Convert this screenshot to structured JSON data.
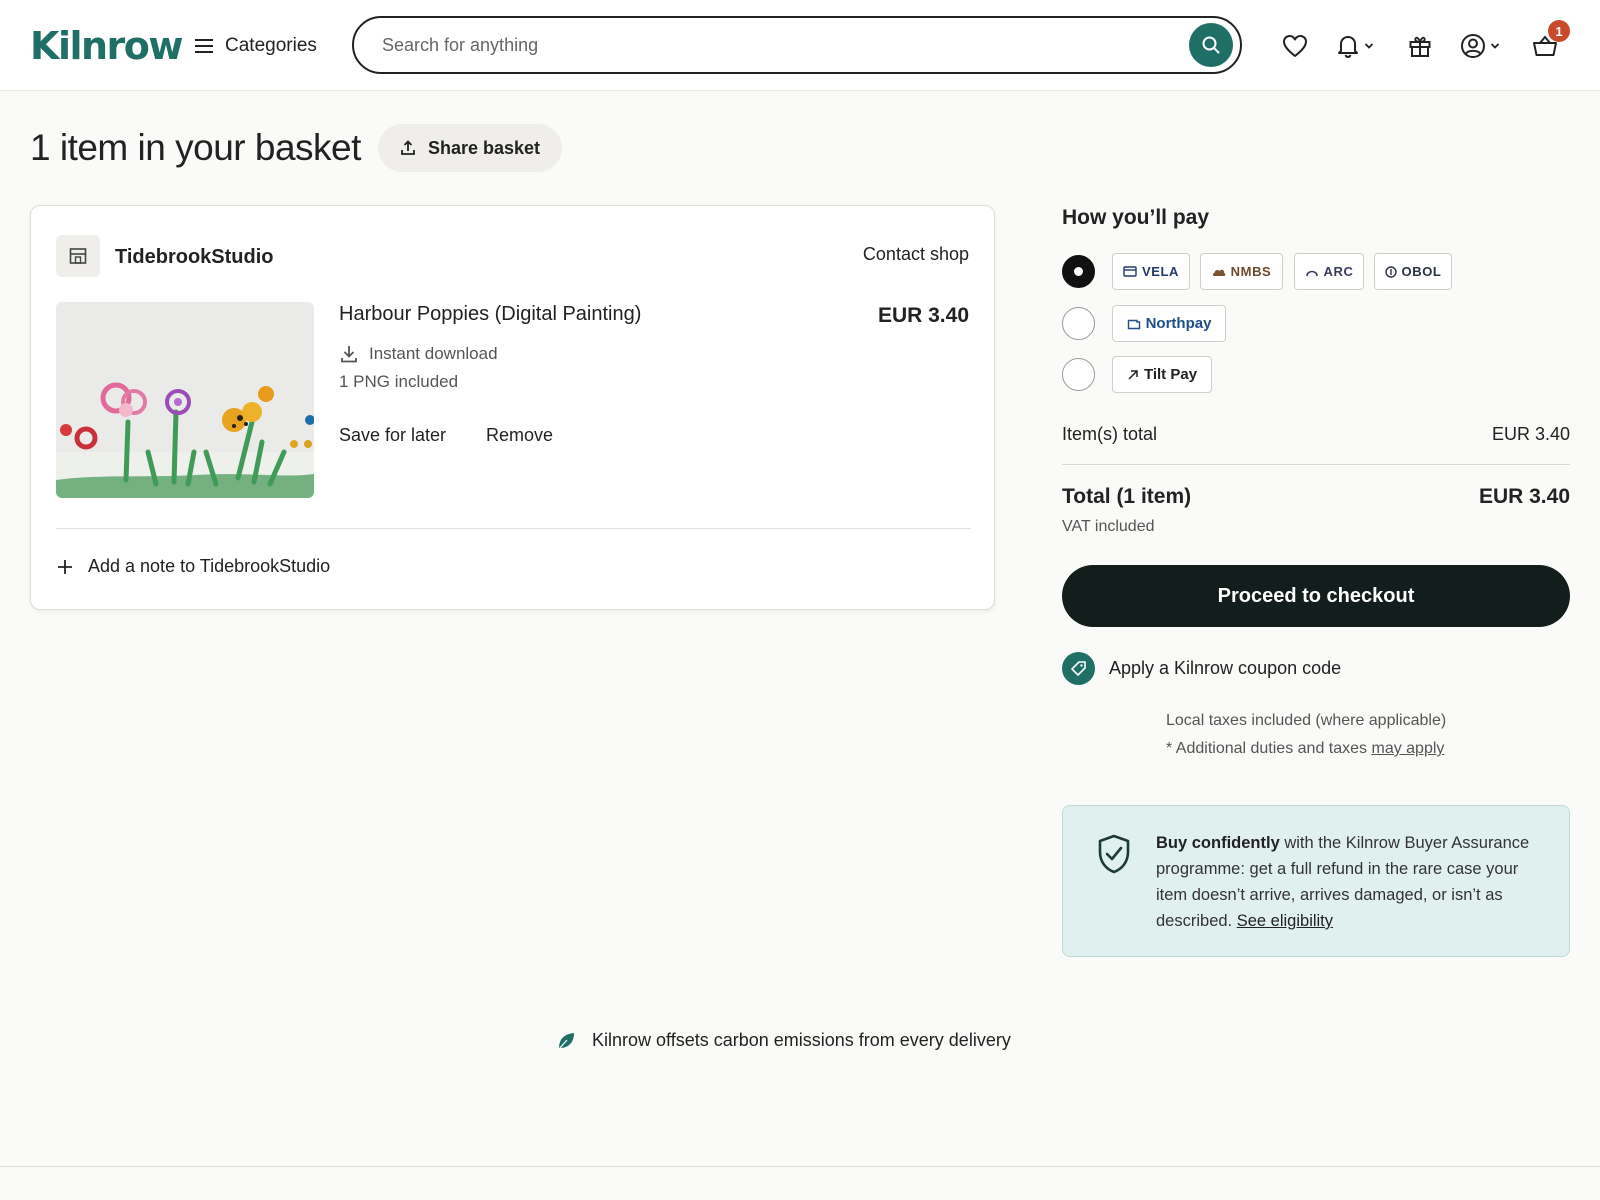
{
  "header": {
    "logo": "Kilnrow",
    "categories_label": "Categories",
    "search_placeholder": "Search for anything",
    "cart_count": "1"
  },
  "page": {
    "title": "1 item in your basket",
    "share_label": "Share basket"
  },
  "shop": {
    "name": "TidebrookStudio",
    "contact_label": "Contact shop",
    "item": {
      "title": "Harbour Poppies (Digital Painting)",
      "price": "EUR 3.40",
      "delivery": "Instant download",
      "files": "1 PNG included",
      "save_label": "Save for later",
      "remove_label": "Remove"
    },
    "note_label": "Add a note to TidebrookStudio"
  },
  "payment": {
    "heading": "How you’ll pay",
    "options": [
      {
        "brands": [
          "VELA",
          "NMBS",
          "ARC",
          "OBOL"
        ],
        "selected": true
      },
      {
        "brands": [
          "Northpay"
        ],
        "selected": false
      },
      {
        "brands": [
          "Tilt Pay"
        ],
        "selected": false
      }
    ],
    "items_total_label": "Item(s) total",
    "items_total_value": "EUR 3.40",
    "total_label": "Total (1 item)",
    "total_value": "EUR 3.40",
    "vat_note": "VAT included",
    "checkout_label": "Proceed to checkout",
    "coupon_label": "Apply a Kilnrow coupon code",
    "tax_note_1": "Local taxes included (where applicable)",
    "tax_note_2": "* Additional duties and taxes ",
    "tax_link": "may apply"
  },
  "assurance": {
    "bold": "Buy confidently",
    "text": " with the Kilnrow Buyer Assurance programme: get a full refund in the rare case your item doesn’t arrive, arrives damaged, or isn’t as described. ",
    "link": "See eligibility"
  },
  "footer": {
    "carbon_text": "Kilnrow offsets carbon emissions from every delivery"
  },
  "colors": {
    "brand": "#1f6f67",
    "checkout": "#131d1c",
    "badge": "#c84a2a",
    "assurance_bg": "#e0f0ef"
  }
}
